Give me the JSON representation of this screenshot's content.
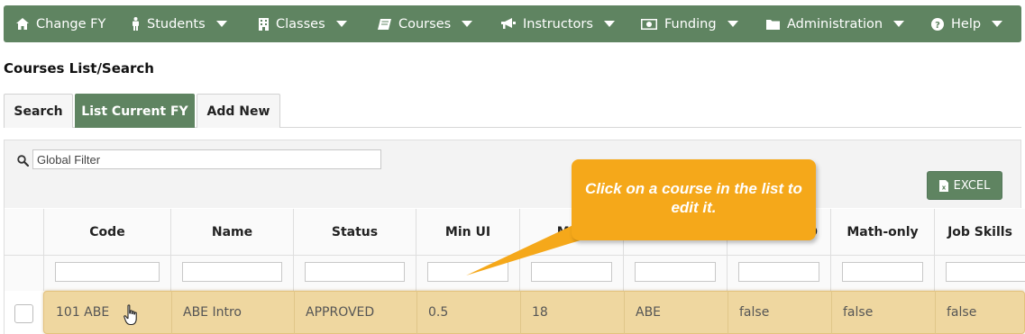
{
  "navbar": {
    "items": [
      {
        "label": "Change FY",
        "icon": "home-icon",
        "caret": false
      },
      {
        "label": "Students",
        "icon": "person-icon",
        "caret": true
      },
      {
        "label": "Classes",
        "icon": "building-icon",
        "caret": true
      },
      {
        "label": "Courses",
        "icon": "book-icon",
        "caret": true
      },
      {
        "label": "Instructors",
        "icon": "bullhorn-icon",
        "caret": true
      },
      {
        "label": "Funding",
        "icon": "money-icon",
        "caret": true
      },
      {
        "label": "Administration",
        "icon": "folder-icon",
        "caret": true
      },
      {
        "label": "Help",
        "icon": "question-circle-icon",
        "caret": true
      }
    ],
    "color": "#5f8461"
  },
  "page": {
    "title": "Courses List/Search"
  },
  "tabs": [
    {
      "label": "Search",
      "active": false
    },
    {
      "label": "List Current FY",
      "active": true
    },
    {
      "label": "Add New",
      "active": false
    }
  ],
  "toolbar": {
    "filter_placeholder": "Global Filter",
    "excel_label": "EXCEL"
  },
  "table": {
    "columns": [
      "Code",
      "Name",
      "Status",
      "Min UI",
      "Max",
      "",
      "D",
      "Math-only",
      "Job Skills"
    ],
    "rows": [
      {
        "selected": false,
        "cells": [
          "101 ABE",
          "ABE Intro",
          "APPROVED",
          "0.5",
          "18",
          "ABE",
          "false",
          "false",
          "false"
        ]
      }
    ],
    "highlight_color": "#efd7a0"
  },
  "callout": {
    "text": "Click on a course in the list to edit it.",
    "color": "#f5a81a"
  }
}
